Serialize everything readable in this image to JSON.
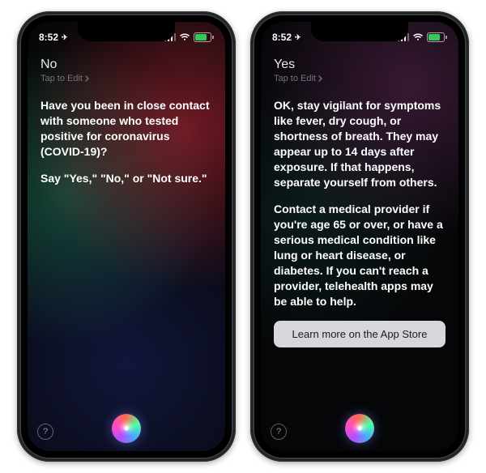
{
  "status": {
    "time": "8:52",
    "location_glyph": "➤"
  },
  "left_phone": {
    "user_response": "No",
    "tap_to_edit": "Tap to Edit",
    "para1": "Have you been in close contact with someone who tested positive for coronavirus (COVID-19)?",
    "para2": "Say \"Yes,\" \"No,\" or \"Not sure.\""
  },
  "right_phone": {
    "user_response": "Yes",
    "tap_to_edit": "Tap to Edit",
    "para1": "OK, stay vigilant for symptoms like fever, dry cough, or shortness of breath. They may appear up to 14 days after exposure. If that happens, separate yourself from others.",
    "para2": "Contact a medical provider if you're age 65 or over, or have a serious medical condition like lung or heart disease, or diabetes. If you can't reach a provider, telehealth apps may be able to help.",
    "button_label": "Learn more on the App Store"
  },
  "help_glyph": "?"
}
